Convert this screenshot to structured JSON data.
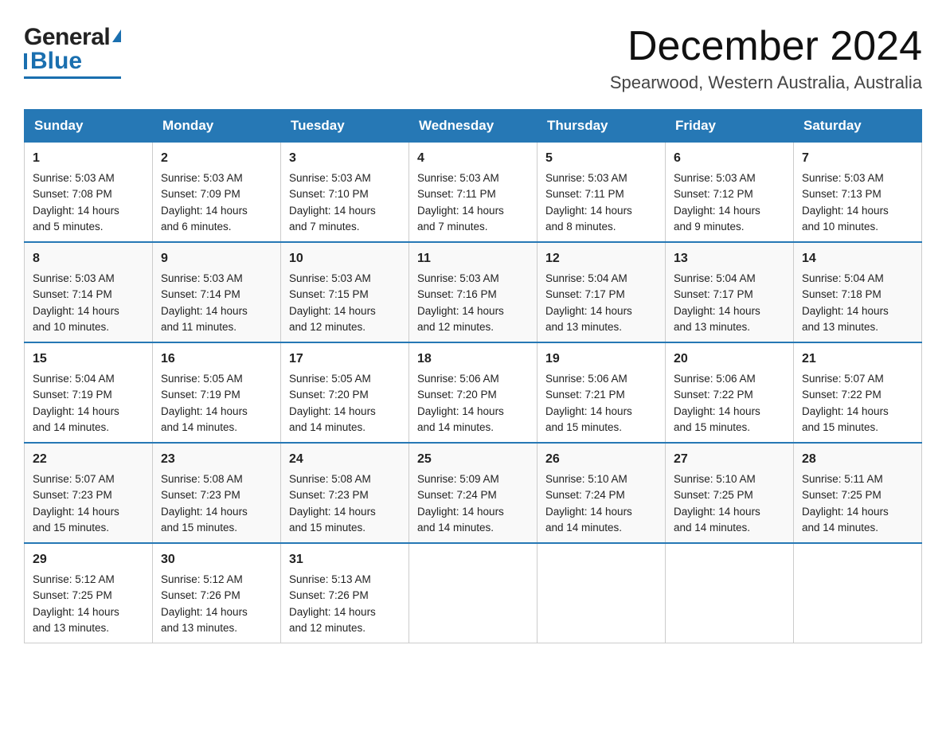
{
  "header": {
    "logo_general": "General",
    "logo_blue": "Blue",
    "main_title": "December 2024",
    "subtitle": "Spearwood, Western Australia, Australia"
  },
  "days_of_week": [
    "Sunday",
    "Monday",
    "Tuesday",
    "Wednesday",
    "Thursday",
    "Friday",
    "Saturday"
  ],
  "weeks": [
    [
      {
        "day": "1",
        "sunrise": "5:03 AM",
        "sunset": "7:08 PM",
        "daylight": "14 hours and 5 minutes."
      },
      {
        "day": "2",
        "sunrise": "5:03 AM",
        "sunset": "7:09 PM",
        "daylight": "14 hours and 6 minutes."
      },
      {
        "day": "3",
        "sunrise": "5:03 AM",
        "sunset": "7:10 PM",
        "daylight": "14 hours and 7 minutes."
      },
      {
        "day": "4",
        "sunrise": "5:03 AM",
        "sunset": "7:11 PM",
        "daylight": "14 hours and 7 minutes."
      },
      {
        "day": "5",
        "sunrise": "5:03 AM",
        "sunset": "7:11 PM",
        "daylight": "14 hours and 8 minutes."
      },
      {
        "day": "6",
        "sunrise": "5:03 AM",
        "sunset": "7:12 PM",
        "daylight": "14 hours and 9 minutes."
      },
      {
        "day": "7",
        "sunrise": "5:03 AM",
        "sunset": "7:13 PM",
        "daylight": "14 hours and 10 minutes."
      }
    ],
    [
      {
        "day": "8",
        "sunrise": "5:03 AM",
        "sunset": "7:14 PM",
        "daylight": "14 hours and 10 minutes."
      },
      {
        "day": "9",
        "sunrise": "5:03 AM",
        "sunset": "7:14 PM",
        "daylight": "14 hours and 11 minutes."
      },
      {
        "day": "10",
        "sunrise": "5:03 AM",
        "sunset": "7:15 PM",
        "daylight": "14 hours and 12 minutes."
      },
      {
        "day": "11",
        "sunrise": "5:03 AM",
        "sunset": "7:16 PM",
        "daylight": "14 hours and 12 minutes."
      },
      {
        "day": "12",
        "sunrise": "5:04 AM",
        "sunset": "7:17 PM",
        "daylight": "14 hours and 13 minutes."
      },
      {
        "day": "13",
        "sunrise": "5:04 AM",
        "sunset": "7:17 PM",
        "daylight": "14 hours and 13 minutes."
      },
      {
        "day": "14",
        "sunrise": "5:04 AM",
        "sunset": "7:18 PM",
        "daylight": "14 hours and 13 minutes."
      }
    ],
    [
      {
        "day": "15",
        "sunrise": "5:04 AM",
        "sunset": "7:19 PM",
        "daylight": "14 hours and 14 minutes."
      },
      {
        "day": "16",
        "sunrise": "5:05 AM",
        "sunset": "7:19 PM",
        "daylight": "14 hours and 14 minutes."
      },
      {
        "day": "17",
        "sunrise": "5:05 AM",
        "sunset": "7:20 PM",
        "daylight": "14 hours and 14 minutes."
      },
      {
        "day": "18",
        "sunrise": "5:06 AM",
        "sunset": "7:20 PM",
        "daylight": "14 hours and 14 minutes."
      },
      {
        "day": "19",
        "sunrise": "5:06 AM",
        "sunset": "7:21 PM",
        "daylight": "14 hours and 15 minutes."
      },
      {
        "day": "20",
        "sunrise": "5:06 AM",
        "sunset": "7:22 PM",
        "daylight": "14 hours and 15 minutes."
      },
      {
        "day": "21",
        "sunrise": "5:07 AM",
        "sunset": "7:22 PM",
        "daylight": "14 hours and 15 minutes."
      }
    ],
    [
      {
        "day": "22",
        "sunrise": "5:07 AM",
        "sunset": "7:23 PM",
        "daylight": "14 hours and 15 minutes."
      },
      {
        "day": "23",
        "sunrise": "5:08 AM",
        "sunset": "7:23 PM",
        "daylight": "14 hours and 15 minutes."
      },
      {
        "day": "24",
        "sunrise": "5:08 AM",
        "sunset": "7:23 PM",
        "daylight": "14 hours and 15 minutes."
      },
      {
        "day": "25",
        "sunrise": "5:09 AM",
        "sunset": "7:24 PM",
        "daylight": "14 hours and 14 minutes."
      },
      {
        "day": "26",
        "sunrise": "5:10 AM",
        "sunset": "7:24 PM",
        "daylight": "14 hours and 14 minutes."
      },
      {
        "day": "27",
        "sunrise": "5:10 AM",
        "sunset": "7:25 PM",
        "daylight": "14 hours and 14 minutes."
      },
      {
        "day": "28",
        "sunrise": "5:11 AM",
        "sunset": "7:25 PM",
        "daylight": "14 hours and 14 minutes."
      }
    ],
    [
      {
        "day": "29",
        "sunrise": "5:12 AM",
        "sunset": "7:25 PM",
        "daylight": "14 hours and 13 minutes."
      },
      {
        "day": "30",
        "sunrise": "5:12 AM",
        "sunset": "7:26 PM",
        "daylight": "14 hours and 13 minutes."
      },
      {
        "day": "31",
        "sunrise": "5:13 AM",
        "sunset": "7:26 PM",
        "daylight": "14 hours and 12 minutes."
      },
      null,
      null,
      null,
      null
    ]
  ],
  "labels": {
    "sunrise_prefix": "Sunrise: ",
    "sunset_prefix": "Sunset: ",
    "daylight_prefix": "Daylight: "
  }
}
